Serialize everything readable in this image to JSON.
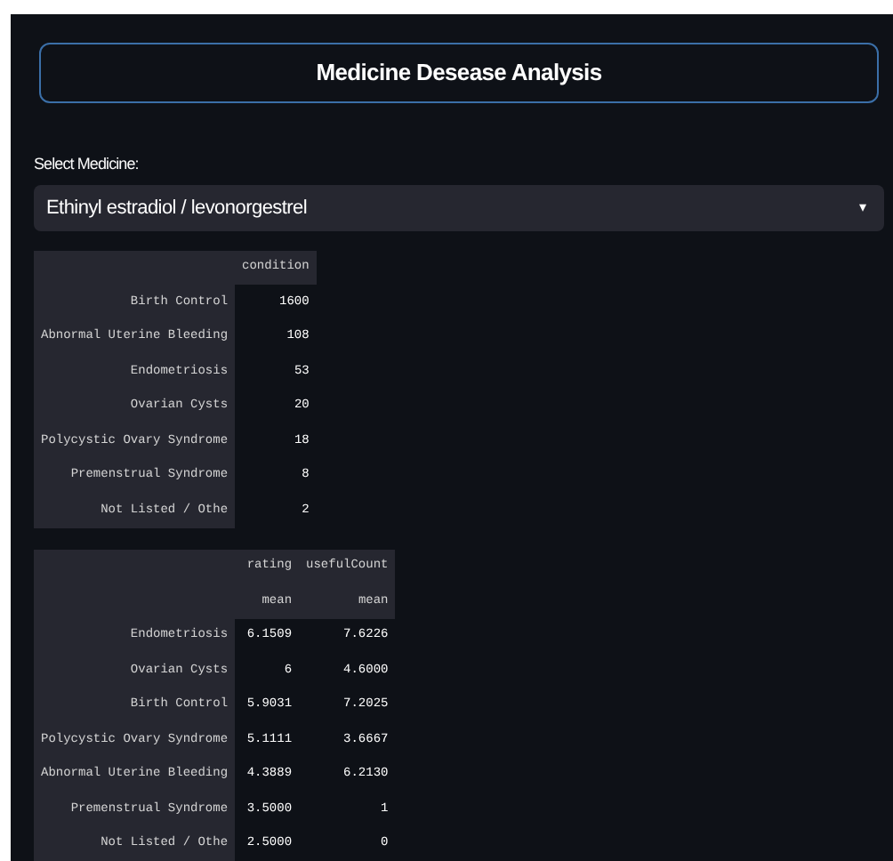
{
  "title": "Medicine Desease Analysis",
  "select": {
    "label": "Select Medicine:",
    "value": "Ethinyl estradiol / levonorgestrel",
    "arrow": "▾"
  },
  "table_1": {
    "columns": [
      "condition"
    ],
    "rows": [
      {
        "index": "Birth Control",
        "values": [
          "1600"
        ]
      },
      {
        "index": "Abnormal Uterine Bleeding",
        "values": [
          "108"
        ]
      },
      {
        "index": "Endometriosis",
        "values": [
          "53"
        ]
      },
      {
        "index": "Ovarian Cysts",
        "values": [
          "20"
        ]
      },
      {
        "index": "Polycystic Ovary Syndrome",
        "values": [
          "18"
        ]
      },
      {
        "index": "Premenstrual Syndrome",
        "values": [
          "8"
        ]
      },
      {
        "index": "Not Listed / Othe",
        "values": [
          "2"
        ]
      }
    ]
  },
  "table_2": {
    "columns": [
      "rating",
      "usefulCount"
    ],
    "subcolumns": [
      "mean",
      "mean"
    ],
    "rows": [
      {
        "index": "Endometriosis",
        "values": [
          "6.1509",
          "7.6226"
        ]
      },
      {
        "index": "Ovarian Cysts",
        "values": [
          "6",
          "4.6000"
        ]
      },
      {
        "index": "Birth Control",
        "values": [
          "5.9031",
          "7.2025"
        ]
      },
      {
        "index": "Polycystic Ovary Syndrome",
        "values": [
          "5.1111",
          "3.6667"
        ]
      },
      {
        "index": "Abnormal Uterine Bleeding",
        "values": [
          "4.3889",
          "6.2130"
        ]
      },
      {
        "index": "Premenstrual Syndrome",
        "values": [
          "3.5000",
          "1"
        ]
      },
      {
        "index": "Not Listed / Othe",
        "values": [
          "2.5000",
          "0"
        ]
      }
    ]
  }
}
